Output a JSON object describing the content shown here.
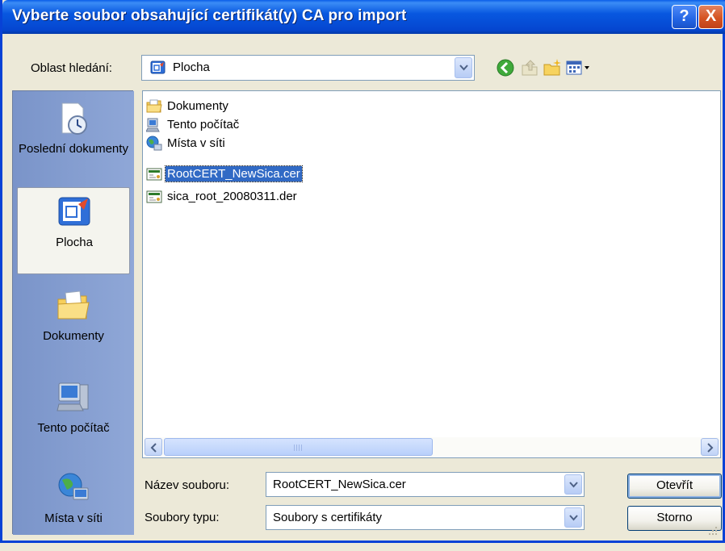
{
  "window": {
    "title": "Vyberte soubor obsahující certifikát(y) CA pro import",
    "help_label": "?",
    "close_label": "X"
  },
  "lookin": {
    "label": "Oblast hledání:",
    "value": "Plocha"
  },
  "places": [
    {
      "label": "Poslední dokumenty",
      "icon": "recent-documents-icon",
      "selected": false
    },
    {
      "label": "Plocha",
      "icon": "desktop-icon",
      "selected": true
    },
    {
      "label": "Dokumenty",
      "icon": "documents-folder-icon",
      "selected": false
    },
    {
      "label": "Tento počítač",
      "icon": "computer-icon",
      "selected": false
    },
    {
      "label": "Místa v síti",
      "icon": "network-places-icon",
      "selected": false
    }
  ],
  "files": [
    {
      "label": "Dokumenty",
      "icon": "folder-icon"
    },
    {
      "label": "Tento počítač",
      "icon": "computer-icon"
    },
    {
      "label": "Místa v síti",
      "icon": "network-icon"
    },
    {
      "label": "RootCERT_NewSica.cer",
      "icon": "certificate-icon",
      "selected": true
    },
    {
      "label": "sica_root_20080311.der",
      "icon": "certificate-icon"
    }
  ],
  "filename": {
    "label": "Název souboru:",
    "value": "RootCERT_NewSica.cer"
  },
  "filetype": {
    "label": "Soubory typu:",
    "value": "Soubory s certifikáty"
  },
  "buttons": {
    "open": "Otevřít",
    "cancel": "Storno"
  },
  "colors": {
    "titlebar": "#0858E0",
    "selection": "#316AC5",
    "dialog_bg": "#ECE9D8"
  }
}
